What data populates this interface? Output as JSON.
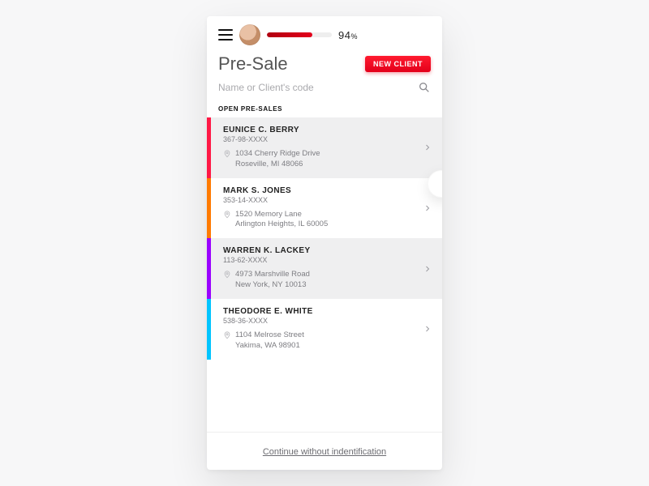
{
  "topbar": {
    "progress_pct": "94",
    "progress_unit": "%"
  },
  "header": {
    "title": "Pre-Sale",
    "new_client_label": "NEW CLIENT"
  },
  "search": {
    "placeholder": "Name or Client's code"
  },
  "section": {
    "open_label": "OPEN PRE-SALES"
  },
  "clients": [
    {
      "stripe": "#ff1845",
      "name": "EUNICE C. BERRY",
      "code": "367-98-XXXX",
      "addr1": "1034 Cherry Ridge Drive",
      "addr2": "Roseville, MI 48066",
      "alt": true
    },
    {
      "stripe": "#ff7a00",
      "name": "MARK S. JONES",
      "code": "353-14-XXXX",
      "addr1": "1520 Memory Lane",
      "addr2": "Arlington Heights, IL 60005",
      "alt": false
    },
    {
      "stripe": "#9a00ff",
      "name": "WARREN K. LACKEY",
      "code": "113-62-XXXX",
      "addr1": "4973 Marshville Road",
      "addr2": "New York, NY 10013",
      "alt": true
    },
    {
      "stripe": "#00c5ff",
      "name": "THEODORE E. WHITE",
      "code": "538-36-XXXX",
      "addr1": "1104 Melrose Street",
      "addr2": "Yakima, WA 98901",
      "alt": false
    }
  ],
  "footer": {
    "continue_label": "Continue without indentification"
  }
}
